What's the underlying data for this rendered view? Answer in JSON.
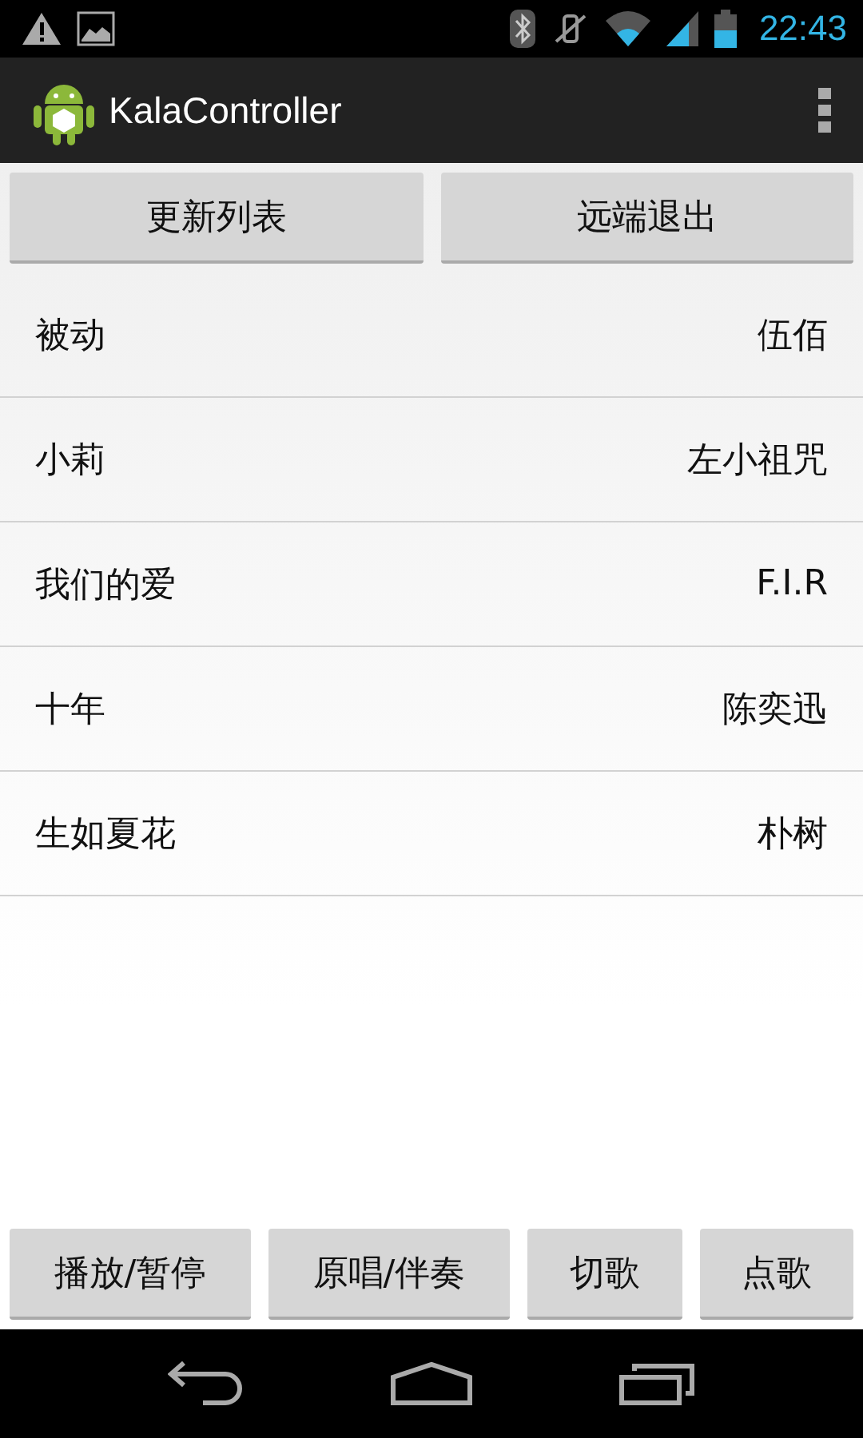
{
  "status_bar": {
    "time": "22:43"
  },
  "action_bar": {
    "title": "KalaController"
  },
  "top_buttons": [
    "更新列表",
    "远端退出"
  ],
  "songs": [
    {
      "title": "被动",
      "artist": "伍佰"
    },
    {
      "title": "小莉",
      "artist": "左小祖咒"
    },
    {
      "title": "我们的爱",
      "artist": "F.I.R"
    },
    {
      "title": "十年",
      "artist": "陈奕迅"
    },
    {
      "title": "生如夏花",
      "artist": "朴树"
    }
  ],
  "bottom_buttons": [
    "播放/暂停",
    "原唱/伴奏",
    "切歌",
    "点歌"
  ]
}
